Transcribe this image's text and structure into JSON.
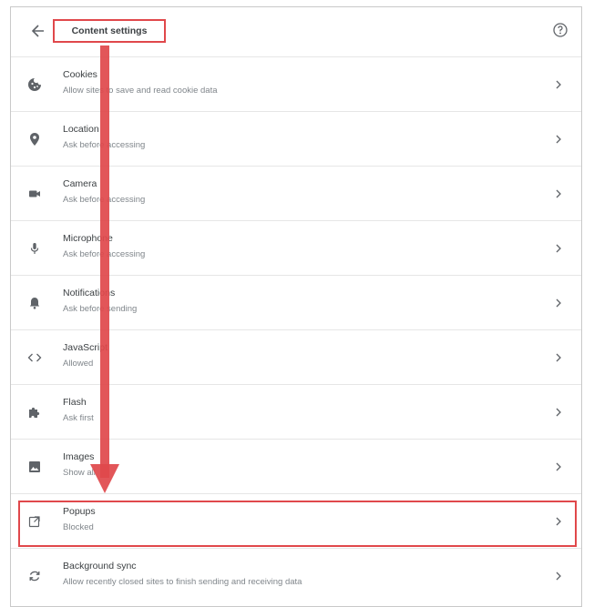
{
  "header": {
    "title": "Content settings"
  },
  "settings": [
    {
      "label": "Cookies",
      "desc": "Allow sites to save and read cookie data",
      "icon": "cookie-icon"
    },
    {
      "label": "Location",
      "desc": "Ask before accessing",
      "icon": "location-pin-icon"
    },
    {
      "label": "Camera",
      "desc": "Ask before accessing",
      "icon": "camera-icon"
    },
    {
      "label": "Microphone",
      "desc": "Ask before accessing",
      "icon": "microphone-icon"
    },
    {
      "label": "Notifications",
      "desc": "Ask before sending",
      "icon": "bell-icon"
    },
    {
      "label": "JavaScript",
      "desc": "Allowed",
      "icon": "code-icon"
    },
    {
      "label": "Flash",
      "desc": "Ask first",
      "icon": "puzzle-icon"
    },
    {
      "label": "Images",
      "desc": "Show all",
      "icon": "image-icon"
    },
    {
      "label": "Popups",
      "desc": "Blocked",
      "icon": "popup-icon"
    },
    {
      "label": "Background sync",
      "desc": "Allow recently closed sites to finish sending and receiving data",
      "icon": "sync-icon"
    }
  ],
  "colors": {
    "annotation": "#e0484b",
    "icon": "#5f6368",
    "divider": "#e6e6e6"
  }
}
